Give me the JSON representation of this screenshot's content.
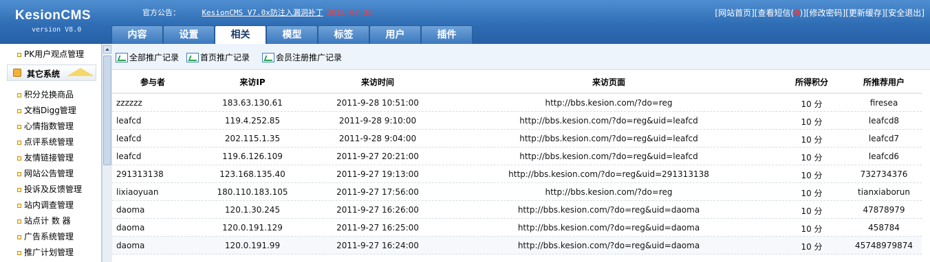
{
  "brand": {
    "title": "KesionCMS",
    "version": "version V8.0"
  },
  "notice": {
    "label": "官方公告：",
    "link": "KesionCMS V7.0x防注入漏洞补丁",
    "date": "2011-07-25"
  },
  "top_links": {
    "home": "[网站首页]",
    "messages_prefix": "[查看短信(",
    "messages_count": "0",
    "messages_suffix": ")]",
    "password": "[修改密码]",
    "cache": "[更新缓存]",
    "logout": "[安全退出]"
  },
  "tabs": [
    {
      "label": "内容"
    },
    {
      "label": "设置"
    },
    {
      "label": "相关"
    },
    {
      "label": "模型"
    },
    {
      "label": "标签"
    },
    {
      "label": "用户"
    },
    {
      "label": "插件"
    }
  ],
  "active_tab_index": 2,
  "sidebar": {
    "top_item": "PK用户观点管理",
    "group_title": "其它系统",
    "items": [
      "积分兑换商品",
      "文档Digg管理",
      "心情指数管理",
      "点评系统管理",
      "友情链接管理",
      "网站公告管理",
      "投诉及反馈管理",
      "站内调查管理",
      "站点计 数 器",
      "广告系统管理",
      "推广计划管理"
    ]
  },
  "toolbar": {
    "all": "全部推广记录",
    "home": "首页推广记录",
    "reg": "会员注册推广记录"
  },
  "table": {
    "headers": {
      "participant": "参与者",
      "ip": "来访IP",
      "time": "来访时间",
      "page": "来访页面",
      "points": "所得积分",
      "referrer": "所推荐用户"
    },
    "rows": [
      {
        "participant": "zzzzzz",
        "ip": "183.63.130.61",
        "time": "2011-9-28 10:51:00",
        "page": "http://bbs.kesion.com/?do=reg",
        "points": "10 分",
        "referrer": "firesea"
      },
      {
        "participant": "leafcd",
        "ip": "119.4.252.85",
        "time": "2011-9-28 9:10:00",
        "page": "http://bbs.kesion.com/?do=reg&uid=leafcd",
        "points": "10 分",
        "referrer": "leafcd8"
      },
      {
        "participant": "leafcd",
        "ip": "202.115.1.35",
        "time": "2011-9-28 9:04:00",
        "page": "http://bbs.kesion.com/?do=reg&uid=leafcd",
        "points": "10 分",
        "referrer": "leafcd7"
      },
      {
        "participant": "leafcd",
        "ip": "119.6.126.109",
        "time": "2011-9-27 20:21:00",
        "page": "http://bbs.kesion.com/?do=reg&uid=leafcd",
        "points": "10 分",
        "referrer": "leafcd6"
      },
      {
        "participant": "291313138",
        "ip": "123.168.135.40",
        "time": "2011-9-27 19:13:00",
        "page": "http://bbs.kesion.com/?do=reg&uid=291313138",
        "points": "10 分",
        "referrer": "732734376"
      },
      {
        "participant": "lixiaoyuan",
        "ip": "180.110.183.105",
        "time": "2011-9-27 17:56:00",
        "page": "http://bbs.kesion.com/?do=reg",
        "points": "10 分",
        "referrer": "tianxiaborun"
      },
      {
        "participant": "daoma",
        "ip": "120.1.30.245",
        "time": "2011-9-27 16:26:00",
        "page": "http://bbs.kesion.com/?do=reg&uid=daoma",
        "points": "10 分",
        "referrer": "47878979"
      },
      {
        "participant": "daoma",
        "ip": "120.0.191.129",
        "time": "2011-9-27 16:25:00",
        "page": "http://bbs.kesion.com/?do=reg&uid=daoma",
        "points": "10 分",
        "referrer": "458784"
      },
      {
        "participant": "daoma",
        "ip": "120.0.191.99",
        "time": "2011-9-27 16:24:00",
        "page": "http://bbs.kesion.com/?do=reg&uid=daoma",
        "points": "10 分",
        "referrer": "45748979874"
      }
    ]
  }
}
